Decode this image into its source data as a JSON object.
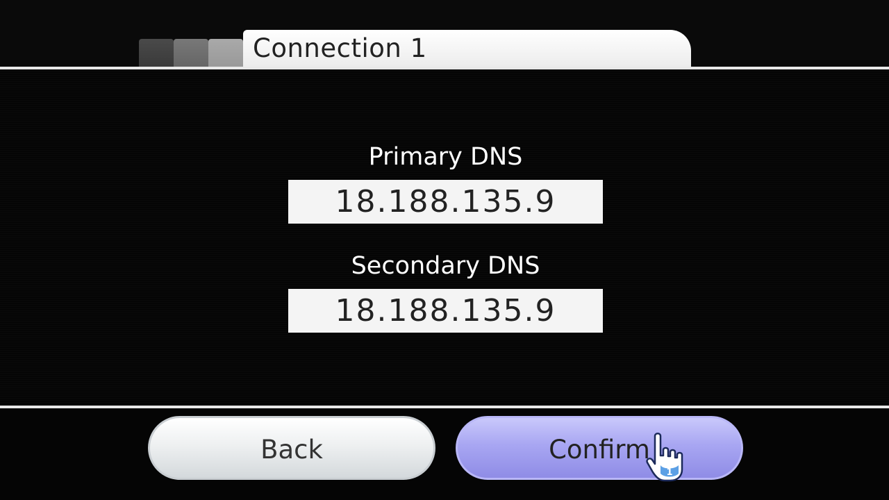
{
  "header": {
    "title": "Connection 1"
  },
  "fields": {
    "primary_dns": {
      "label": "Primary DNS",
      "value": "18.188.135.9"
    },
    "secondary_dns": {
      "label": "Secondary DNS",
      "value": "18.188.135.9"
    }
  },
  "footer": {
    "back_label": "Back",
    "confirm_label": "Confirm"
  },
  "cursor": {
    "icon": "wii-hand-pointer-icon",
    "player_number": "1"
  },
  "colors": {
    "confirm_accent": "#a8a6f2",
    "background": "#050505"
  }
}
